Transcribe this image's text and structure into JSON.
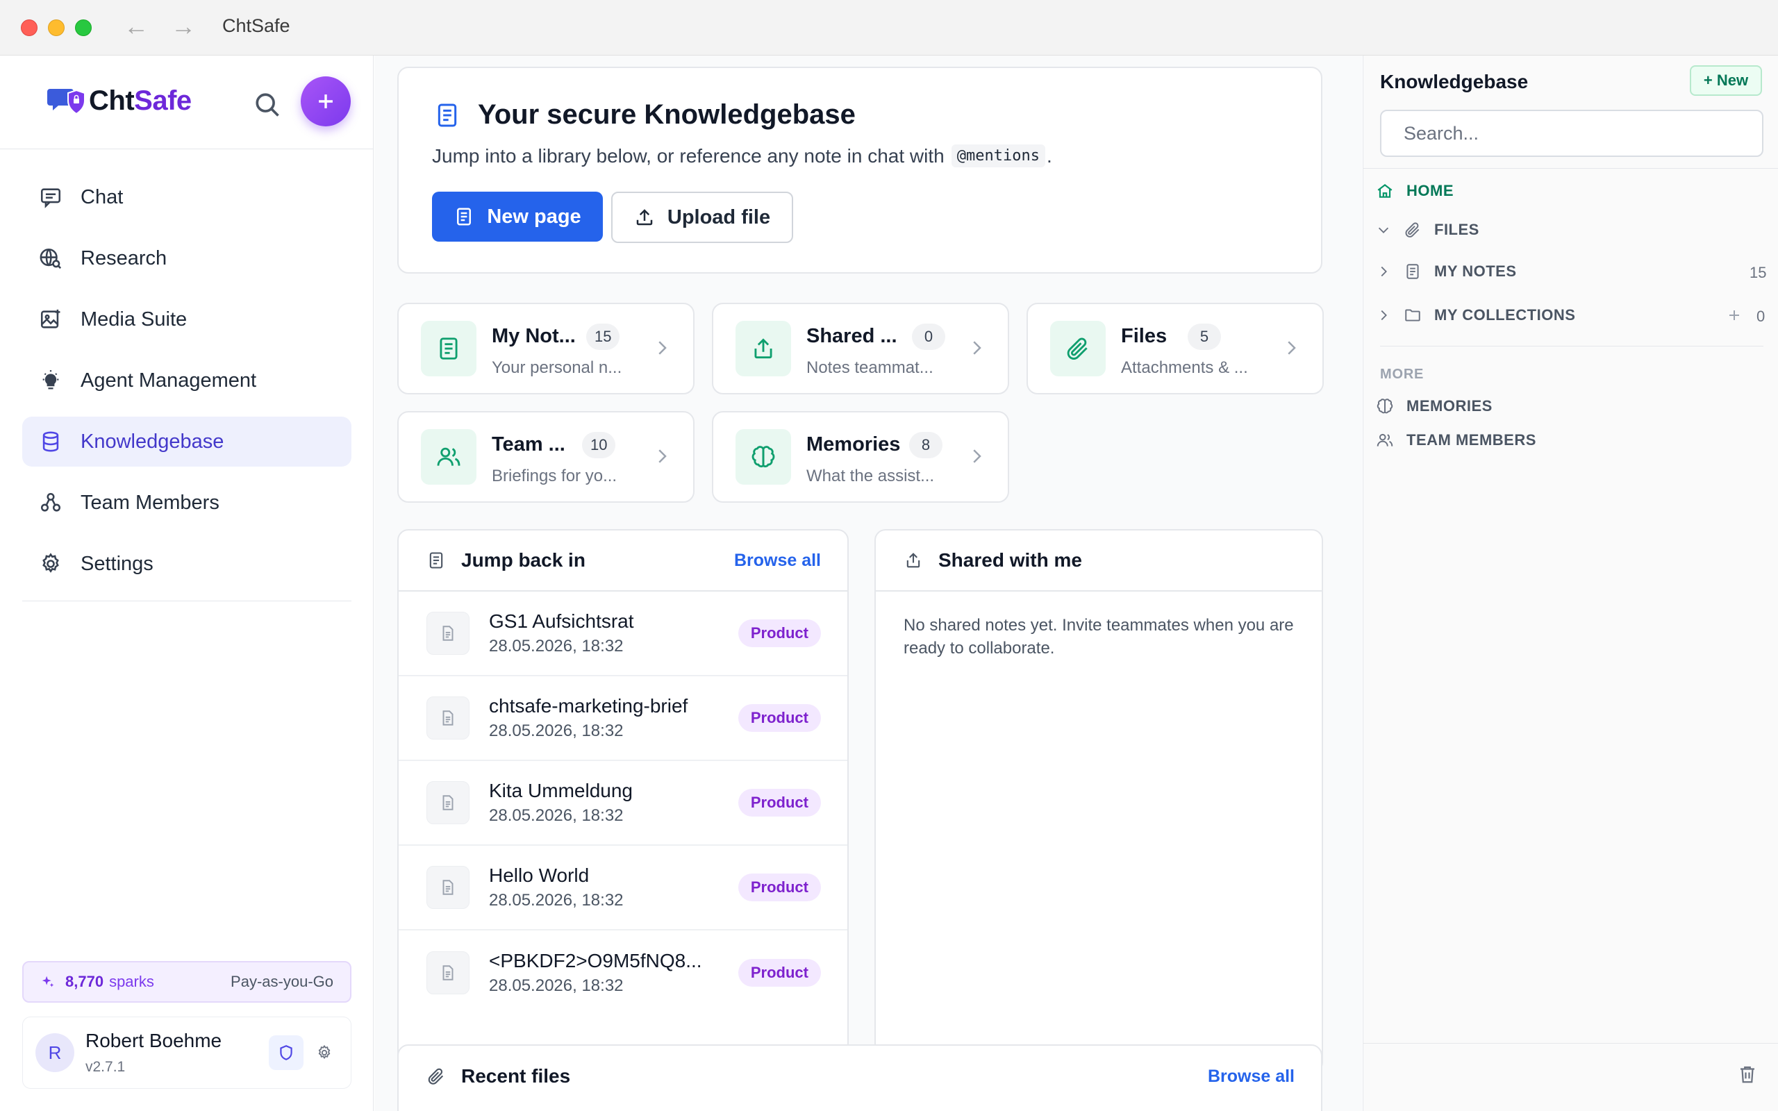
{
  "window": {
    "title": "ChtSafe"
  },
  "brand": {
    "part1": "Cht",
    "part2": "Safe"
  },
  "sidebar": {
    "items": [
      {
        "label": "Chat",
        "icon": "chat-icon"
      },
      {
        "label": "Research",
        "icon": "globe-search-icon"
      },
      {
        "label": "Media Suite",
        "icon": "image-icon"
      },
      {
        "label": "Agent Management",
        "icon": "lightbulb-icon"
      },
      {
        "label": "Knowledgebase",
        "icon": "database-icon",
        "active": true
      },
      {
        "label": "Team Members",
        "icon": "team-icon"
      },
      {
        "label": "Settings",
        "icon": "gear-icon"
      }
    ],
    "sparks": {
      "count": "8,770",
      "unit": "sparks",
      "plan": "Pay-as-you-Go"
    },
    "user": {
      "initial": "R",
      "name": "Robert Boehme",
      "version": "v2.7.1"
    }
  },
  "hero": {
    "title": "Your secure Knowledgebase",
    "subtitle": "Jump into a library below, or reference any note in chat with",
    "mention": "@mentions",
    "subtitle_end": ".",
    "primary_button": "New page",
    "secondary_button": "Upload file"
  },
  "libraries": [
    {
      "title": "My Not...",
      "count": "15",
      "desc": "Your personal n..."
    },
    {
      "title": "Shared ...",
      "count": "0",
      "desc": "Notes teammat..."
    },
    {
      "title": "Files",
      "count": "5",
      "desc": "Attachments & ..."
    },
    {
      "title": "Team ...",
      "count": "10",
      "desc": "Briefings for yo..."
    },
    {
      "title": "Memories",
      "count": "8",
      "desc": "What the assist..."
    }
  ],
  "jump": {
    "title": "Jump back in",
    "link": "Browse all",
    "rows": [
      {
        "title": "GS1 Aufsichtsrat",
        "date": "28.05.2026, 18:32",
        "tag": "Product"
      },
      {
        "title": "chtsafe-marketing-brief",
        "date": "28.05.2026, 18:32",
        "tag": "Product"
      },
      {
        "title": "Kita Ummeldung",
        "date": "28.05.2026, 18:32",
        "tag": "Product"
      },
      {
        "title": "Hello World",
        "date": "28.05.2026, 18:32",
        "tag": "Product"
      },
      {
        "title": "<PBKDF2>O9M5fNQ8...",
        "date": "28.05.2026, 18:32",
        "tag": "Product"
      }
    ]
  },
  "shared": {
    "title": "Shared with me",
    "empty": "No shared notes yet. Invite teammates when you are ready to collaborate."
  },
  "recent": {
    "title": "Recent files",
    "link": "Browse all"
  },
  "rightpanel": {
    "title": "Knowledgebase",
    "new_button": "+ New",
    "search_placeholder": "Search...",
    "home": "HOME",
    "files": "FILES",
    "my_notes": "MY NOTES",
    "my_notes_count": "15",
    "my_collections": "MY COLLECTIONS",
    "my_collections_count": "0",
    "more": "MORE",
    "memories": "MEMORIES",
    "team_members": "TEAM MEMBERS"
  }
}
